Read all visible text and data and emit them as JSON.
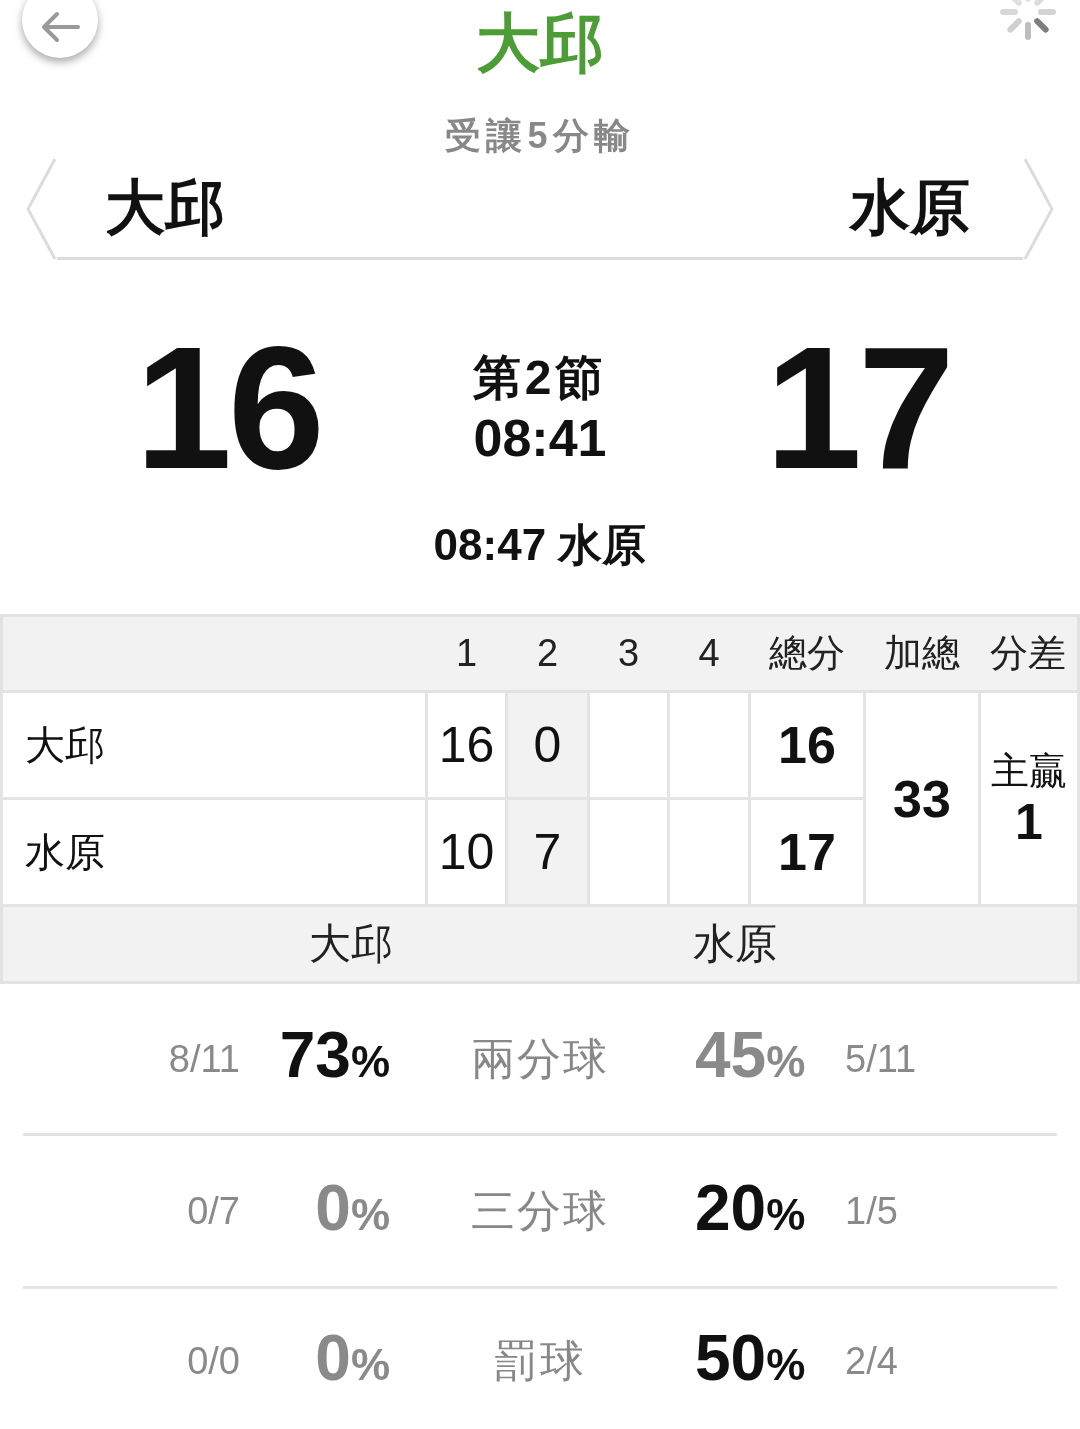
{
  "header": {
    "title": "大邱",
    "subtitle": "受讓5分輸"
  },
  "teams": [
    {
      "name": "大邱"
    },
    {
      "name": "水原"
    }
  ],
  "scoreboard": {
    "home_score": "16",
    "period": "第2節",
    "clock": "08:41",
    "away_score": "17",
    "last_score": "08:47 水原"
  },
  "boxscore": {
    "quarter_columns": [
      {
        "label": "1",
        "current": false
      },
      {
        "label": "2",
        "current": true
      },
      {
        "label": "3",
        "current": false
      },
      {
        "label": "4",
        "current": false
      }
    ],
    "total_column": "總分",
    "sum_column": "加總",
    "diff_column": "分差",
    "rows": [
      {
        "team": "大邱",
        "quarters": [
          "16",
          "0"
        ],
        "total": "16"
      },
      {
        "team": "水原",
        "quarters": [
          "10",
          "7"
        ],
        "total": "17"
      }
    ],
    "sum": "33",
    "diff_label": "主贏",
    "diff_value": "1"
  },
  "stats_teams": {
    "home": "大邱",
    "away": "水原"
  },
  "stats": [
    {
      "label": "兩分球",
      "home": {
        "fraction": "8/11",
        "percent": "73",
        "unit": "%",
        "leading": true
      },
      "away": {
        "fraction": "5/11",
        "percent": "45",
        "unit": "%",
        "leading": false
      }
    },
    {
      "label": "三分球",
      "home": {
        "fraction": "0/7",
        "percent": "0",
        "unit": "%",
        "leading": false
      },
      "away": {
        "fraction": "1/5",
        "percent": "20",
        "unit": "%",
        "leading": true
      }
    },
    {
      "label": "罰球",
      "home": {
        "fraction": "0/0",
        "percent": "0",
        "unit": "%",
        "leading": false
      },
      "away": {
        "fraction": "2/4",
        "percent": "50",
        "unit": "%",
        "leading": true
      }
    }
  ]
}
